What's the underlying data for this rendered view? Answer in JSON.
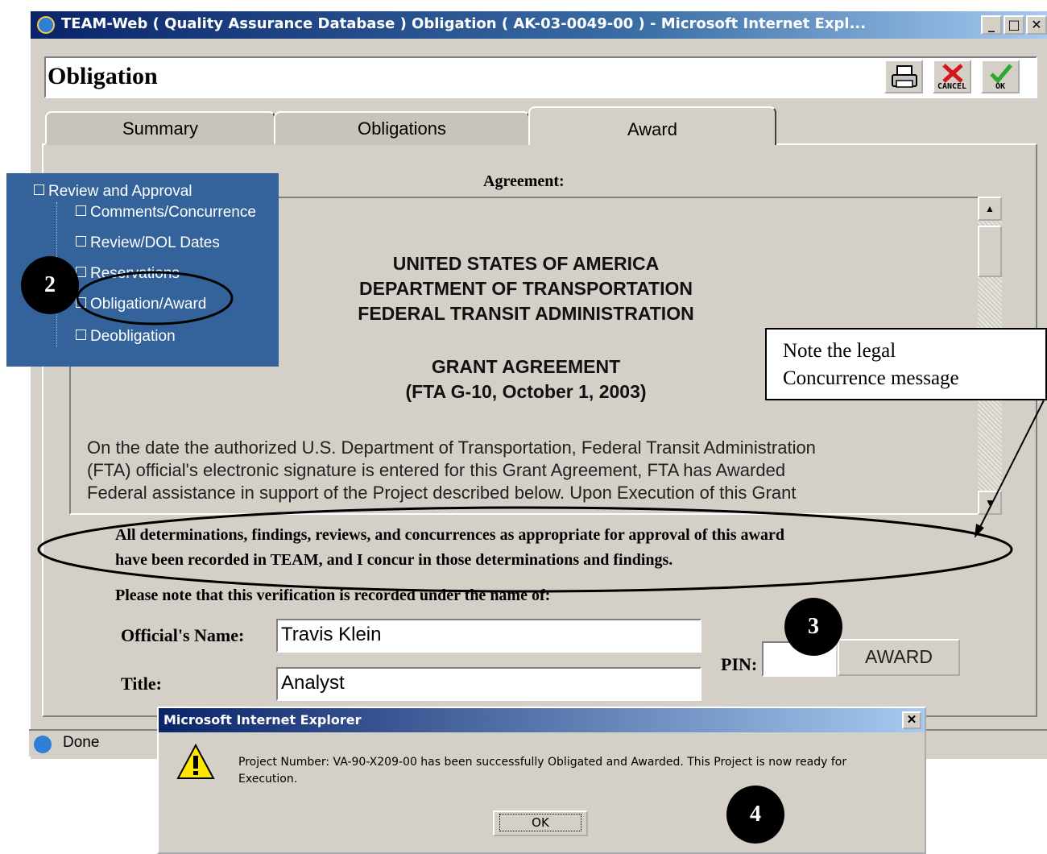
{
  "window": {
    "title": "TEAM-Web ( Quality Assurance Database ) Obligation ( AK-03-0049-00 ) - Microsoft Internet Expl...",
    "minimize": "_",
    "maximize": "□",
    "close": "✕"
  },
  "header": {
    "title": "Obligation",
    "cancel_label": "CANCEL",
    "ok_label": "OK"
  },
  "tabs": [
    {
      "label": "Summary",
      "active": false
    },
    {
      "label": "Obligations",
      "active": false
    },
    {
      "label": "Award",
      "active": true
    }
  ],
  "agreement": {
    "label": "Agreement:",
    "heading_lines": [
      "UNITED STATES OF AMERICA",
      "DEPARTMENT OF TRANSPORTATION",
      "FEDERAL TRANSIT ADMINISTRATION"
    ],
    "subheading_lines": [
      "GRANT AGREEMENT",
      "(FTA G-10, October 1, 2003)"
    ],
    "body_lines": [
      "On the date the authorized U.S. Department of Transportation, Federal Transit Administration",
      "(FTA) official's electronic signature is entered for this Grant Agreement, FTA has Awarded",
      "Federal assistance in support of the Project described below.  Upon Execution of this Grant"
    ]
  },
  "concurrence": {
    "line1": "All determinations, findings, reviews, and concurrences as appropriate for approval of this award",
    "line2": "have been recorded in TEAM, and I concur in those determinations and findings.",
    "verification": "Please note that this verification is recorded under the name of:"
  },
  "form": {
    "official_label": "Official's Name:",
    "official_value": "Travis  Klein",
    "title_label": "Title:",
    "title_value": "Analyst",
    "pin_label": "PIN:",
    "pin_value": "",
    "award_button": "AWARD"
  },
  "statusbar": {
    "text": "Done"
  },
  "tree": {
    "root": "Review and Approval",
    "items": [
      "Comments/Concurrence",
      "Review/DOL Dates",
      "Reservations",
      "Obligation/Award",
      "Deobligation"
    ]
  },
  "callouts": {
    "step2": "2",
    "step3": "3",
    "step4": "4",
    "note_line1": "Note the legal",
    "note_line2": "Concurrence message"
  },
  "dialog": {
    "title": "Microsoft Internet Explorer",
    "close": "✕",
    "message_line1": "Project Number: VA-90-X209-00 has been successfully Obligated and Awarded.  This Project is now ready for",
    "message_line2": "Execution.",
    "ok_label": "OK"
  },
  "colors": {
    "titlebar_start": "#0a246a",
    "tree_bg": "#33639a",
    "window_bg": "#d4d0c8"
  }
}
